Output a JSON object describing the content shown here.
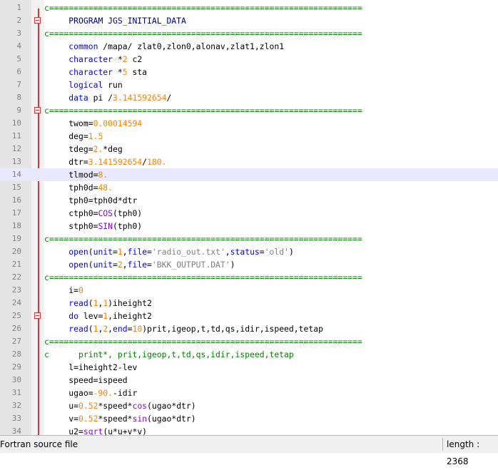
{
  "editor": {
    "current_line": 14,
    "fold_markers": [
      2,
      9,
      25
    ],
    "lines": [
      {
        "n": "1",
        "tokens": [
          {
            "t": "c================================================================",
            "c": "cm"
          }
        ]
      },
      {
        "n": "2",
        "tokens": [
          {
            "t": "     ",
            "c": ""
          },
          {
            "t": "PROGRAM JGS_INITIAL_DATA",
            "c": "prog"
          }
        ]
      },
      {
        "n": "3",
        "tokens": [
          {
            "t": "c================================================================",
            "c": "cm"
          }
        ]
      },
      {
        "n": "4",
        "tokens": [
          {
            "t": "     ",
            "c": ""
          },
          {
            "t": "common",
            "c": "kw"
          },
          {
            "t": " /mapa/ zlat0,zlon0,alonav,zlat1,zlon1",
            "c": ""
          }
        ]
      },
      {
        "n": "5",
        "tokens": [
          {
            "t": "     ",
            "c": ""
          },
          {
            "t": "character",
            "c": "kw"
          },
          {
            "t": " *",
            "c": ""
          },
          {
            "t": "2",
            "c": "num"
          },
          {
            "t": " c2",
            "c": ""
          }
        ]
      },
      {
        "n": "6",
        "tokens": [
          {
            "t": "     ",
            "c": ""
          },
          {
            "t": "character",
            "c": "kw"
          },
          {
            "t": " *",
            "c": ""
          },
          {
            "t": "5",
            "c": "num"
          },
          {
            "t": " sta",
            "c": ""
          }
        ]
      },
      {
        "n": "7",
        "tokens": [
          {
            "t": "     ",
            "c": ""
          },
          {
            "t": "logical",
            "c": "kw"
          },
          {
            "t": " run",
            "c": ""
          }
        ]
      },
      {
        "n": "8",
        "tokens": [
          {
            "t": "     ",
            "c": ""
          },
          {
            "t": "data",
            "c": "kw"
          },
          {
            "t": " pi /",
            "c": ""
          },
          {
            "t": "3.141592654",
            "c": "num"
          },
          {
            "t": "/",
            "c": ""
          }
        ]
      },
      {
        "n": "9",
        "tokens": [
          {
            "t": "c================================================================",
            "c": "cm"
          }
        ]
      },
      {
        "n": "10",
        "tokens": [
          {
            "t": "     twom=",
            "c": ""
          },
          {
            "t": "0.00014594",
            "c": "num"
          }
        ]
      },
      {
        "n": "11",
        "tokens": [
          {
            "t": "     deg=",
            "c": ""
          },
          {
            "t": "1.5",
            "c": "num"
          }
        ]
      },
      {
        "n": "12",
        "tokens": [
          {
            "t": "     tdeg=",
            "c": ""
          },
          {
            "t": "2.",
            "c": "num"
          },
          {
            "t": "*deg",
            "c": ""
          }
        ]
      },
      {
        "n": "13",
        "tokens": [
          {
            "t": "     dtr=",
            "c": ""
          },
          {
            "t": "3.141592654",
            "c": "num"
          },
          {
            "t": "/",
            "c": ""
          },
          {
            "t": "180.",
            "c": "num"
          }
        ]
      },
      {
        "n": "14",
        "tokens": [
          {
            "t": "     tlmod=",
            "c": ""
          },
          {
            "t": "8.",
            "c": "num"
          }
        ]
      },
      {
        "n": "15",
        "tokens": [
          {
            "t": "     tph0d=",
            "c": ""
          },
          {
            "t": "48.",
            "c": "num"
          }
        ]
      },
      {
        "n": "16",
        "tokens": [
          {
            "t": "     tph0=tph0d*dtr",
            "c": ""
          }
        ]
      },
      {
        "n": "17",
        "tokens": [
          {
            "t": "     ctph0=",
            "c": ""
          },
          {
            "t": "COS",
            "c": "fn"
          },
          {
            "t": "(tph0)",
            "c": ""
          }
        ]
      },
      {
        "n": "18",
        "tokens": [
          {
            "t": "     stph0=",
            "c": ""
          },
          {
            "t": "SIN",
            "c": "fn"
          },
          {
            "t": "(tph0)",
            "c": ""
          }
        ]
      },
      {
        "n": "19",
        "tokens": [
          {
            "t": "c================================================================",
            "c": "cm"
          }
        ]
      },
      {
        "n": "20",
        "tokens": [
          {
            "t": "     ",
            "c": ""
          },
          {
            "t": "open",
            "c": "kw"
          },
          {
            "t": "(",
            "c": ""
          },
          {
            "t": "unit",
            "c": "kw"
          },
          {
            "t": "=",
            "c": ""
          },
          {
            "t": "1",
            "c": "num"
          },
          {
            "t": ",",
            "c": ""
          },
          {
            "t": "file",
            "c": "kw"
          },
          {
            "t": "=",
            "c": ""
          },
          {
            "t": "'radio_out.txt'",
            "c": "str"
          },
          {
            "t": ",",
            "c": ""
          },
          {
            "t": "status",
            "c": "kw"
          },
          {
            "t": "=",
            "c": ""
          },
          {
            "t": "'old'",
            "c": "str"
          },
          {
            "t": ")",
            "c": ""
          }
        ]
      },
      {
        "n": "21",
        "tokens": [
          {
            "t": "     ",
            "c": ""
          },
          {
            "t": "open",
            "c": "kw"
          },
          {
            "t": "(",
            "c": ""
          },
          {
            "t": "unit",
            "c": "kw"
          },
          {
            "t": "=",
            "c": ""
          },
          {
            "t": "2",
            "c": "num"
          },
          {
            "t": ",",
            "c": ""
          },
          {
            "t": "file",
            "c": "kw"
          },
          {
            "t": "=",
            "c": ""
          },
          {
            "t": "'BKK_OUTPUT.DAT'",
            "c": "str"
          },
          {
            "t": ")",
            "c": ""
          }
        ]
      },
      {
        "n": "22",
        "tokens": [
          {
            "t": "c================================================================",
            "c": "cm"
          }
        ]
      },
      {
        "n": "23",
        "tokens": [
          {
            "t": "     i=",
            "c": ""
          },
          {
            "t": "0",
            "c": "num"
          }
        ]
      },
      {
        "n": "24",
        "tokens": [
          {
            "t": "     ",
            "c": ""
          },
          {
            "t": "read",
            "c": "kw"
          },
          {
            "t": "(",
            "c": ""
          },
          {
            "t": "1",
            "c": "num"
          },
          {
            "t": ",",
            "c": ""
          },
          {
            "t": "1",
            "c": "num"
          },
          {
            "t": ")iheight2",
            "c": ""
          }
        ]
      },
      {
        "n": "25",
        "tokens": [
          {
            "t": "     ",
            "c": ""
          },
          {
            "t": "do",
            "c": "kw"
          },
          {
            "t": " lev=",
            "c": ""
          },
          {
            "t": "1",
            "c": "num"
          },
          {
            "t": ",iheight2",
            "c": ""
          }
        ]
      },
      {
        "n": "26",
        "tokens": [
          {
            "t": "     ",
            "c": ""
          },
          {
            "t": "read",
            "c": "kw"
          },
          {
            "t": "(",
            "c": ""
          },
          {
            "t": "1",
            "c": "num"
          },
          {
            "t": ",",
            "c": ""
          },
          {
            "t": "2",
            "c": "num"
          },
          {
            "t": ",",
            "c": ""
          },
          {
            "t": "end",
            "c": "kw"
          },
          {
            "t": "=",
            "c": ""
          },
          {
            "t": "10",
            "c": "num"
          },
          {
            "t": ")prit,igeop,t,td,qs,idir,ispeed,tetap",
            "c": ""
          }
        ]
      },
      {
        "n": "27",
        "tokens": [
          {
            "t": "c================================================================",
            "c": "cm"
          }
        ]
      },
      {
        "n": "28",
        "tokens": [
          {
            "t": "c      print*, prit,igeop,t,td,qs,idir,ispeed,tetap",
            "c": "cm"
          }
        ]
      },
      {
        "n": "29",
        "tokens": [
          {
            "t": "     l=iheight2-lev",
            "c": ""
          }
        ]
      },
      {
        "n": "30",
        "tokens": [
          {
            "t": "     speed=ispeed",
            "c": ""
          }
        ]
      },
      {
        "n": "31",
        "tokens": [
          {
            "t": "     ugao=",
            "c": ""
          },
          {
            "t": "-90.",
            "c": "num"
          },
          {
            "t": "-idir",
            "c": ""
          }
        ]
      },
      {
        "n": "32",
        "tokens": [
          {
            "t": "     u=",
            "c": ""
          },
          {
            "t": "0.52",
            "c": "num"
          },
          {
            "t": "*speed*",
            "c": ""
          },
          {
            "t": "cos",
            "c": "fn"
          },
          {
            "t": "(ugao*dtr)",
            "c": ""
          }
        ]
      },
      {
        "n": "33",
        "tokens": [
          {
            "t": "     v=",
            "c": ""
          },
          {
            "t": "0.52",
            "c": "num"
          },
          {
            "t": "*speed*",
            "c": ""
          },
          {
            "t": "sin",
            "c": "fn"
          },
          {
            "t": "(ugao*dtr)",
            "c": ""
          }
        ]
      },
      {
        "n": "34",
        "tokens": [
          {
            "t": "     u2=",
            "c": ""
          },
          {
            "t": "sqrt",
            "c": "fn"
          },
          {
            "t": "(u*u+v*v)",
            "c": ""
          }
        ]
      }
    ]
  },
  "statusbar": {
    "file_type": "Fortran source file",
    "length": "length : 2368"
  }
}
